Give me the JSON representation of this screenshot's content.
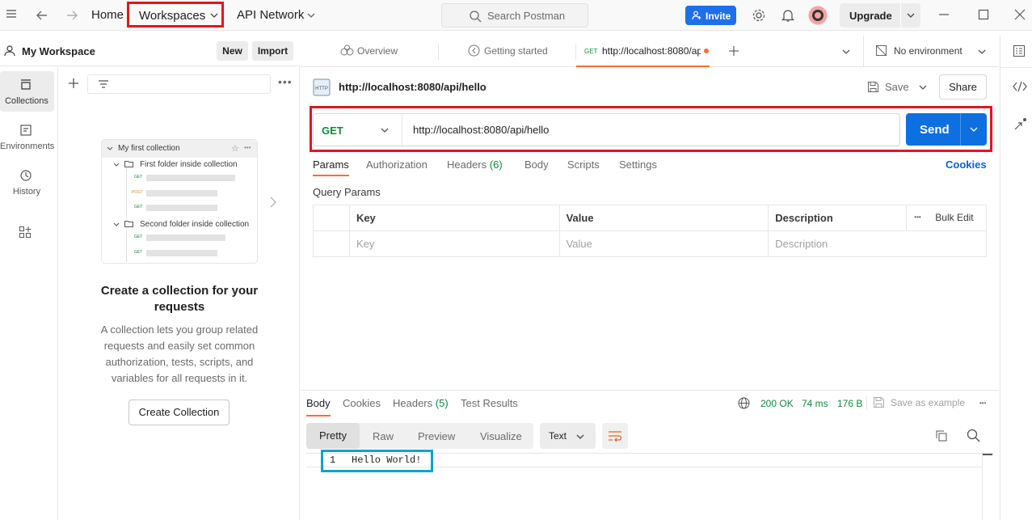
{
  "topbar": {
    "home": "Home",
    "workspaces": "Workspaces",
    "api_network": "API Network",
    "search_placeholder": "Search Postman",
    "invite": "Invite",
    "upgrade": "Upgrade"
  },
  "sidebar": {
    "workspace_name": "My Workspace",
    "new": "New",
    "import": "Import",
    "rail": [
      {
        "label": "Collections",
        "icon": "collections-icon"
      },
      {
        "label": "Environments",
        "icon": "environments-icon"
      },
      {
        "label": "History",
        "icon": "history-icon"
      }
    ],
    "illustration": {
      "collection": "My first collection",
      "folder1": "First folder inside collection",
      "folder2": "Second folder inside collection",
      "methods": [
        "GET",
        "POST",
        "GET",
        "GET",
        "GET"
      ]
    },
    "empty_title": "Create a collection for your requests",
    "empty_desc": "A collection lets you group related requests and easily set common authorization, tests, scripts, and variables for all requests in it.",
    "create_button": "Create Collection"
  },
  "tabs": {
    "overview": "Overview",
    "getting_started": "Getting started",
    "active_method": "GET",
    "active_title": "http://localhost:8080/ap",
    "environment": "No environment"
  },
  "request": {
    "title": "http://localhost:8080/api/hello",
    "save": "Save",
    "share": "Share",
    "method": "GET",
    "url": "http://localhost:8080/api/hello",
    "send": "Send",
    "subtabs": [
      "Params",
      "Authorization",
      "Headers",
      "Body",
      "Scripts",
      "Settings"
    ],
    "headers_count": "(6)",
    "cookies": "Cookies",
    "query_params_label": "Query Params",
    "columns": [
      "Key",
      "Value",
      "Description"
    ],
    "bulk_edit": "Bulk Edit",
    "placeholders": [
      "Key",
      "Value",
      "Description"
    ]
  },
  "response": {
    "tabs": [
      "Body",
      "Cookies",
      "Headers",
      "Test Results"
    ],
    "headers_count": "(5)",
    "status": "200 OK",
    "time": "74 ms",
    "size": "176 B",
    "save_example": "Save as example",
    "views": [
      "Pretty",
      "Raw",
      "Preview",
      "Visualize"
    ],
    "format": "Text",
    "line_number": "1",
    "body_line": "Hello World!"
  },
  "colors": {
    "accent_blue": "#1f6feb",
    "highlight_red": "#e0161f",
    "highlight_cyan": "#0aa3cf",
    "status_green": "#0f8a3c",
    "post_orange": "#e8891f"
  }
}
